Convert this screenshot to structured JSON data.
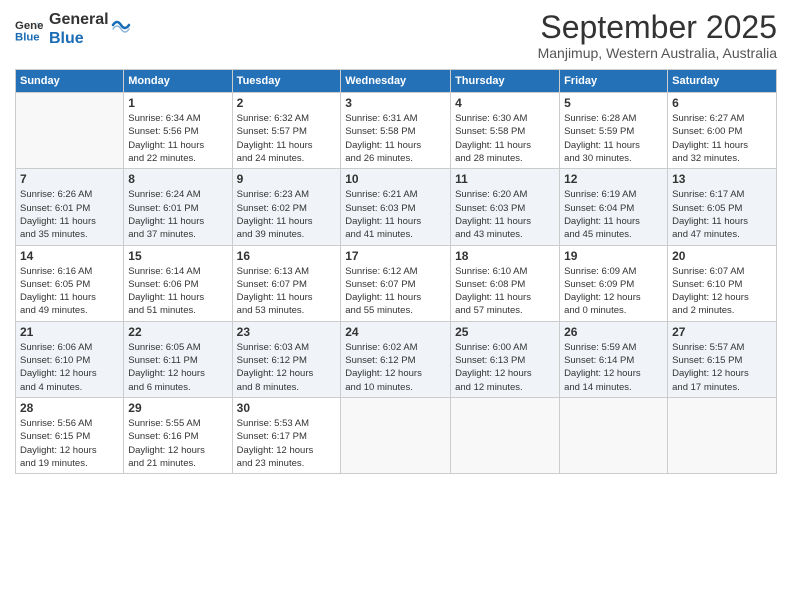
{
  "logo": {
    "general": "General",
    "blue": "Blue"
  },
  "title": "September 2025",
  "location": "Manjimup, Western Australia, Australia",
  "headers": [
    "Sunday",
    "Monday",
    "Tuesday",
    "Wednesday",
    "Thursday",
    "Friday",
    "Saturday"
  ],
  "weeks": [
    [
      {
        "day": "",
        "sunrise": "",
        "sunset": "",
        "daylight": ""
      },
      {
        "day": "1",
        "sunrise": "Sunrise: 6:34 AM",
        "sunset": "Sunset: 5:56 PM",
        "daylight": "Daylight: 11 hours and 22 minutes."
      },
      {
        "day": "2",
        "sunrise": "Sunrise: 6:32 AM",
        "sunset": "Sunset: 5:57 PM",
        "daylight": "Daylight: 11 hours and 24 minutes."
      },
      {
        "day": "3",
        "sunrise": "Sunrise: 6:31 AM",
        "sunset": "Sunset: 5:58 PM",
        "daylight": "Daylight: 11 hours and 26 minutes."
      },
      {
        "day": "4",
        "sunrise": "Sunrise: 6:30 AM",
        "sunset": "Sunset: 5:58 PM",
        "daylight": "Daylight: 11 hours and 28 minutes."
      },
      {
        "day": "5",
        "sunrise": "Sunrise: 6:28 AM",
        "sunset": "Sunset: 5:59 PM",
        "daylight": "Daylight: 11 hours and 30 minutes."
      },
      {
        "day": "6",
        "sunrise": "Sunrise: 6:27 AM",
        "sunset": "Sunset: 6:00 PM",
        "daylight": "Daylight: 11 hours and 32 minutes."
      }
    ],
    [
      {
        "day": "7",
        "sunrise": "Sunrise: 6:26 AM",
        "sunset": "Sunset: 6:01 PM",
        "daylight": "Daylight: 11 hours and 35 minutes."
      },
      {
        "day": "8",
        "sunrise": "Sunrise: 6:24 AM",
        "sunset": "Sunset: 6:01 PM",
        "daylight": "Daylight: 11 hours and 37 minutes."
      },
      {
        "day": "9",
        "sunrise": "Sunrise: 6:23 AM",
        "sunset": "Sunset: 6:02 PM",
        "daylight": "Daylight: 11 hours and 39 minutes."
      },
      {
        "day": "10",
        "sunrise": "Sunrise: 6:21 AM",
        "sunset": "Sunset: 6:03 PM",
        "daylight": "Daylight: 11 hours and 41 minutes."
      },
      {
        "day": "11",
        "sunrise": "Sunrise: 6:20 AM",
        "sunset": "Sunset: 6:03 PM",
        "daylight": "Daylight: 11 hours and 43 minutes."
      },
      {
        "day": "12",
        "sunrise": "Sunrise: 6:19 AM",
        "sunset": "Sunset: 6:04 PM",
        "daylight": "Daylight: 11 hours and 45 minutes."
      },
      {
        "day": "13",
        "sunrise": "Sunrise: 6:17 AM",
        "sunset": "Sunset: 6:05 PM",
        "daylight": "Daylight: 11 hours and 47 minutes."
      }
    ],
    [
      {
        "day": "14",
        "sunrise": "Sunrise: 6:16 AM",
        "sunset": "Sunset: 6:05 PM",
        "daylight": "Daylight: 11 hours and 49 minutes."
      },
      {
        "day": "15",
        "sunrise": "Sunrise: 6:14 AM",
        "sunset": "Sunset: 6:06 PM",
        "daylight": "Daylight: 11 hours and 51 minutes."
      },
      {
        "day": "16",
        "sunrise": "Sunrise: 6:13 AM",
        "sunset": "Sunset: 6:07 PM",
        "daylight": "Daylight: 11 hours and 53 minutes."
      },
      {
        "day": "17",
        "sunrise": "Sunrise: 6:12 AM",
        "sunset": "Sunset: 6:07 PM",
        "daylight": "Daylight: 11 hours and 55 minutes."
      },
      {
        "day": "18",
        "sunrise": "Sunrise: 6:10 AM",
        "sunset": "Sunset: 6:08 PM",
        "daylight": "Daylight: 11 hours and 57 minutes."
      },
      {
        "day": "19",
        "sunrise": "Sunrise: 6:09 AM",
        "sunset": "Sunset: 6:09 PM",
        "daylight": "Daylight: 12 hours and 0 minutes."
      },
      {
        "day": "20",
        "sunrise": "Sunrise: 6:07 AM",
        "sunset": "Sunset: 6:10 PM",
        "daylight": "Daylight: 12 hours and 2 minutes."
      }
    ],
    [
      {
        "day": "21",
        "sunrise": "Sunrise: 6:06 AM",
        "sunset": "Sunset: 6:10 PM",
        "daylight": "Daylight: 12 hours and 4 minutes."
      },
      {
        "day": "22",
        "sunrise": "Sunrise: 6:05 AM",
        "sunset": "Sunset: 6:11 PM",
        "daylight": "Daylight: 12 hours and 6 minutes."
      },
      {
        "day": "23",
        "sunrise": "Sunrise: 6:03 AM",
        "sunset": "Sunset: 6:12 PM",
        "daylight": "Daylight: 12 hours and 8 minutes."
      },
      {
        "day": "24",
        "sunrise": "Sunrise: 6:02 AM",
        "sunset": "Sunset: 6:12 PM",
        "daylight": "Daylight: 12 hours and 10 minutes."
      },
      {
        "day": "25",
        "sunrise": "Sunrise: 6:00 AM",
        "sunset": "Sunset: 6:13 PM",
        "daylight": "Daylight: 12 hours and 12 minutes."
      },
      {
        "day": "26",
        "sunrise": "Sunrise: 5:59 AM",
        "sunset": "Sunset: 6:14 PM",
        "daylight": "Daylight: 12 hours and 14 minutes."
      },
      {
        "day": "27",
        "sunrise": "Sunrise: 5:57 AM",
        "sunset": "Sunset: 6:15 PM",
        "daylight": "Daylight: 12 hours and 17 minutes."
      }
    ],
    [
      {
        "day": "28",
        "sunrise": "Sunrise: 5:56 AM",
        "sunset": "Sunset: 6:15 PM",
        "daylight": "Daylight: 12 hours and 19 minutes."
      },
      {
        "day": "29",
        "sunrise": "Sunrise: 5:55 AM",
        "sunset": "Sunset: 6:16 PM",
        "daylight": "Daylight: 12 hours and 21 minutes."
      },
      {
        "day": "30",
        "sunrise": "Sunrise: 5:53 AM",
        "sunset": "Sunset: 6:17 PM",
        "daylight": "Daylight: 12 hours and 23 minutes."
      },
      {
        "day": "",
        "sunrise": "",
        "sunset": "",
        "daylight": ""
      },
      {
        "day": "",
        "sunrise": "",
        "sunset": "",
        "daylight": ""
      },
      {
        "day": "",
        "sunrise": "",
        "sunset": "",
        "daylight": ""
      },
      {
        "day": "",
        "sunrise": "",
        "sunset": "",
        "daylight": ""
      }
    ]
  ]
}
